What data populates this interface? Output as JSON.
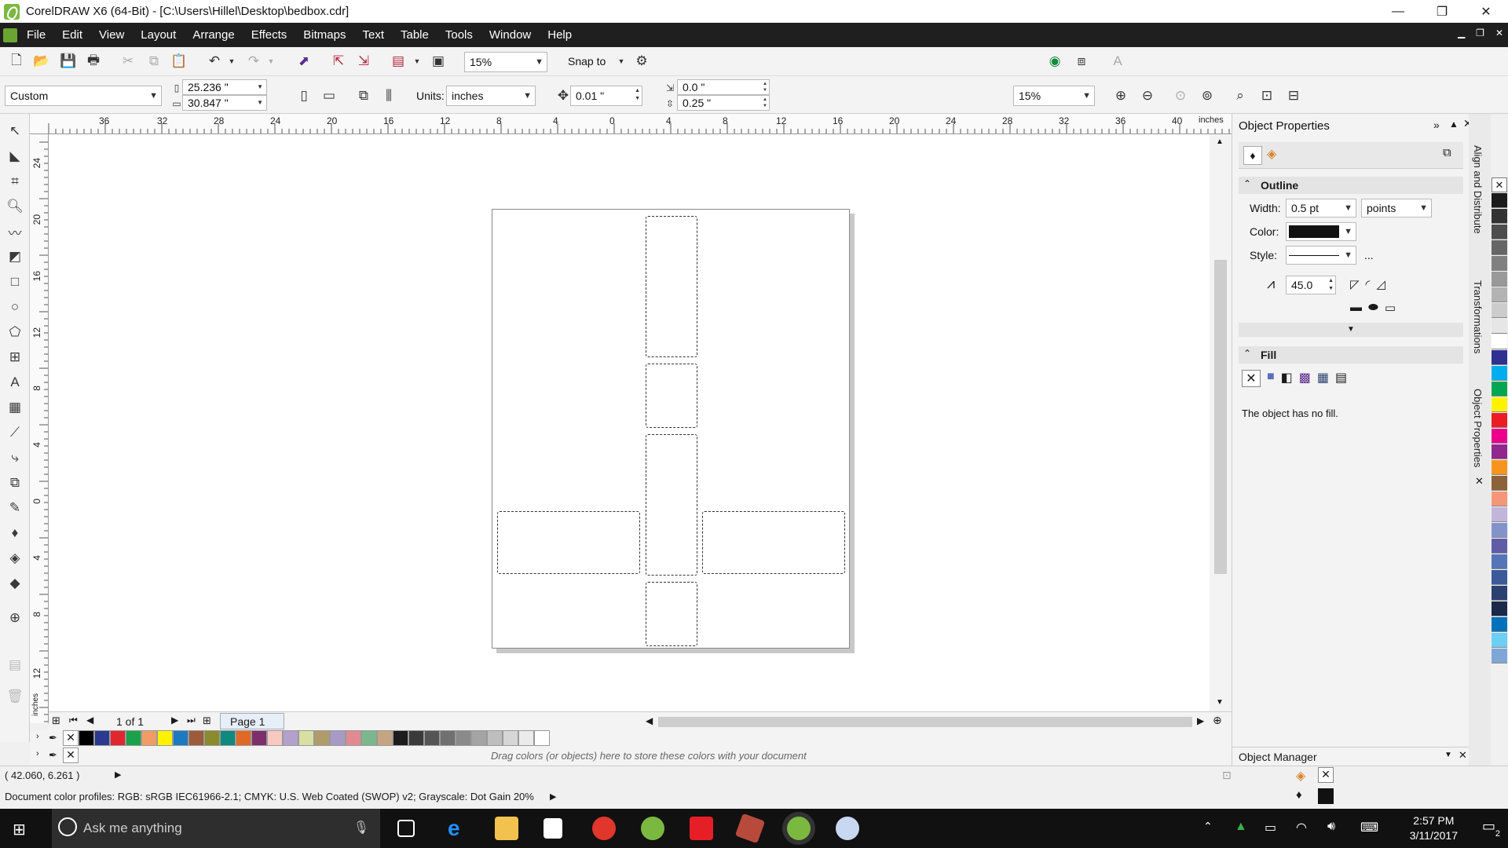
{
  "window": {
    "title": "CorelDRAW X6 (64-Bit) - [C:\\Users\\Hillel\\Desktop\\bedbox.cdr]",
    "minimize": "—",
    "restore": "❐",
    "close": "✕"
  },
  "menu": {
    "items": [
      "File",
      "Edit",
      "View",
      "Layout",
      "Arrange",
      "Effects",
      "Bitmaps",
      "Text",
      "Table",
      "Tools",
      "Window",
      "Help"
    ]
  },
  "toolbar": {
    "zoom_value": "15%",
    "snap_to": "Snap to"
  },
  "property_bar": {
    "preset": "Custom",
    "width": "25.236 \"",
    "height": "30.847 \"",
    "units_label": "Units:",
    "units_value": "inches",
    "nudge": "0.01 \"",
    "dup_x": "0.0 \"",
    "dup_y": "0.25 \"",
    "zoom_value": "15%"
  },
  "hruler": {
    "labels": [
      "36",
      "32",
      "28",
      "24",
      "20",
      "16",
      "12",
      "8",
      "4",
      "0",
      "4",
      "8",
      "12",
      "16",
      "20",
      "24",
      "28",
      "32",
      "36",
      "40"
    ],
    "unit": "inches"
  },
  "vruler": {
    "labels": [
      "24",
      "20",
      "16",
      "12",
      "8",
      "4",
      "0",
      "4",
      "8",
      "12"
    ],
    "unit": "inches"
  },
  "page_nav": {
    "count": "1 of 1",
    "tab": "Page 1"
  },
  "doc_palette_hint": "Drag colors (or objects) here to store these colors with your document",
  "palette": {
    "colors": [
      "#000000",
      "#2b3a8f",
      "#e1262d",
      "#1aa14a",
      "#f19c65",
      "#fff200",
      "#1e7ac0",
      "#9c5b3b",
      "#8a8b2b",
      "#0f8a7f",
      "#e06a25",
      "#7c2f6b",
      "#f7c9c0",
      "#b2a0cd",
      "#d7e0a0",
      "#b09b6a",
      "#a79bc5",
      "#e08b91",
      "#7ab78b",
      "#c4a482",
      "#1c1c1c",
      "#3a3a3a",
      "#555555",
      "#707070",
      "#8a8a8a",
      "#a4a4a4",
      "#bebebe",
      "#d6d6d6",
      "#ebebeb",
      "#ffffff"
    ]
  },
  "right_palette": {
    "colors": [
      "#1a1a1a",
      "#333333",
      "#4d4d4d",
      "#666666",
      "#808080",
      "#999999",
      "#b3b3b3",
      "#cccccc",
      "#e6e6e6",
      "#ffffff",
      "#2e3192",
      "#00aeef",
      "#00a651",
      "#fff200",
      "#ed1c24",
      "#ec008c",
      "#92278f",
      "#f7941d",
      "#8c6239",
      "#f69679",
      "#c2b5dc",
      "#8393ca",
      "#605ca8",
      "#5574b9",
      "#3c5a99",
      "#2b4170",
      "#1c2a4a",
      "#0072bc",
      "#6dcff6",
      "#7ea7d8"
    ]
  },
  "docker": {
    "title": "Object Properties",
    "outline_header": "Outline",
    "width_label": "Width:",
    "width_value": "0.5 pt",
    "width_unit": "points",
    "color_label": "Color:",
    "style_label": "Style:",
    "style_more": "...",
    "miter_value": "45.0",
    "fill_header": "Fill",
    "fill_message": "The object has no fill.",
    "object_manager": "Object Manager"
  },
  "vtabs": {
    "align": "Align and Distribute",
    "transformations": "Transformations",
    "object_properties": "Object Properties"
  },
  "status": {
    "coords": "( 42.060, 6.261 )",
    "color_profiles": "Document color profiles: RGB: sRGB IEC61966-2.1; CMYK: U.S. Web Coated (SWOP) v2; Grayscale: Dot Gain 20%"
  },
  "taskbar": {
    "search_placeholder": "Ask me anything",
    "time": "2:57 PM",
    "date": "3/11/2017",
    "notifications": "2"
  }
}
